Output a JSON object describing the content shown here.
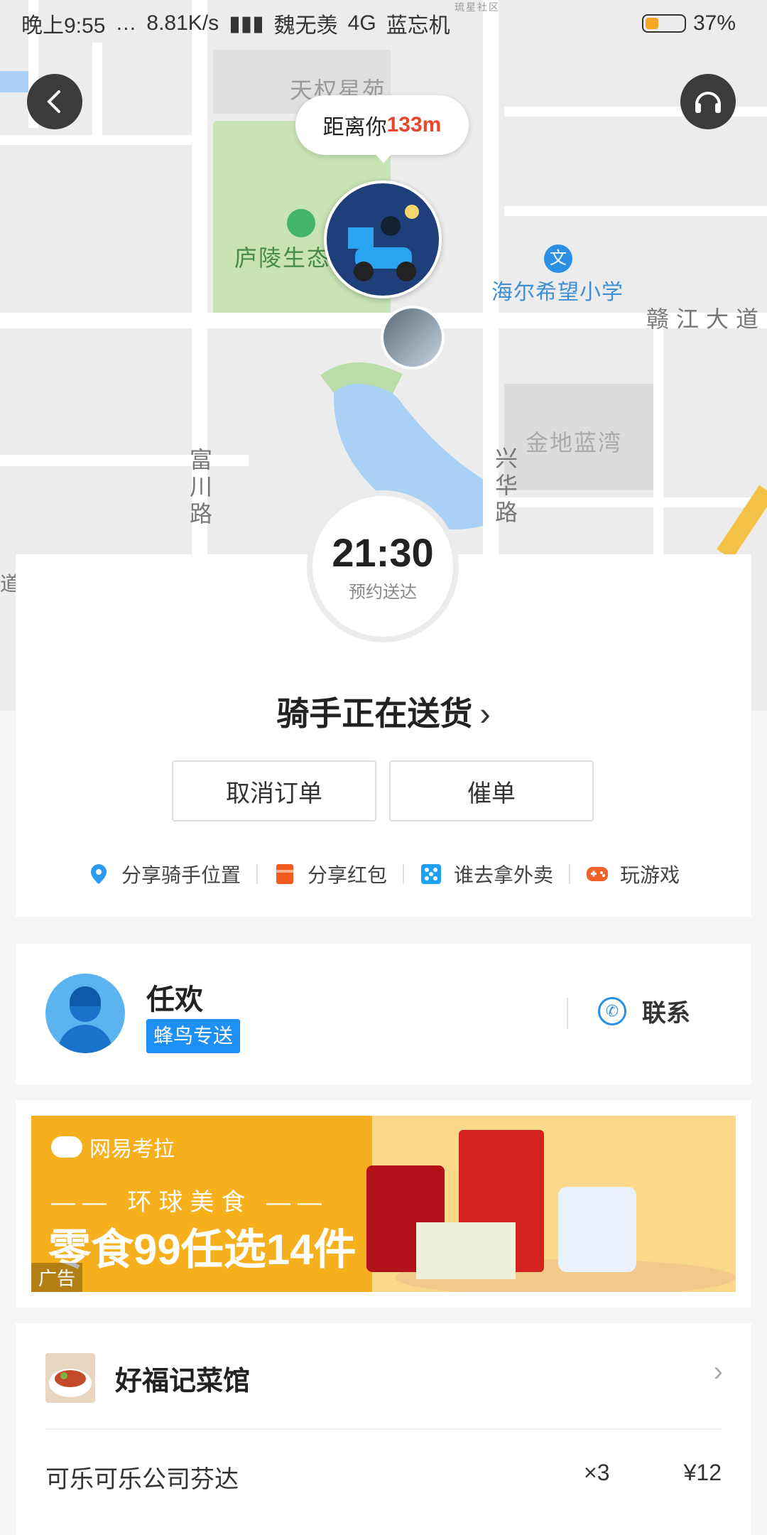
{
  "status_bar": {
    "time": "晚上9:55",
    "network_speed": "8.81K/s",
    "carrier_1": "魏无羡",
    "network_type": "4G",
    "carrier_2": "蓝忘机",
    "battery": "37%"
  },
  "map": {
    "labels": {
      "tianquan": "天权星苑",
      "luling": "庐陵生态",
      "haier": "海尔希望小学",
      "ganjiang": "赣江大道",
      "jindi": "金地蓝湾",
      "fuchuan": "富川路",
      "xinghua": "兴华路",
      "small_top": "琉星社区",
      "edge_left": "道"
    },
    "distance_prefix": "距离你",
    "distance_value": "133m"
  },
  "timer": {
    "time": "21:30",
    "label": "预约送达"
  },
  "delivery": {
    "status": "骑手正在送货",
    "cancel_label": "取消订单",
    "urge_label": "催单",
    "actions": [
      {
        "label": "分享骑手位置",
        "icon": "location-pin-icon",
        "color": "#2b9bf0"
      },
      {
        "label": "分享红包",
        "icon": "red-envelope-icon",
        "color": "#f25a1f"
      },
      {
        "label": "谁去拿外卖",
        "icon": "dice-icon",
        "color": "#1ea1f2"
      },
      {
        "label": "玩游戏",
        "icon": "gamepad-icon",
        "color": "#f2632a"
      }
    ]
  },
  "rider": {
    "name": "任欢",
    "tag": "蜂鸟专送",
    "contact_label": "联系"
  },
  "ad": {
    "brand": "网易考拉",
    "subtitle": "环球美食",
    "headline": "零食99任选14件",
    "tag": "广告"
  },
  "order": {
    "shop_name": "好福记菜馆",
    "items": [
      {
        "name": "可乐可乐公司芬达",
        "qty": "×3",
        "price": "¥12"
      }
    ]
  },
  "colors": {
    "accent_blue": "#1e8ff5",
    "distance_red": "#e8452b",
    "ad_orange": "#f7b01d"
  }
}
